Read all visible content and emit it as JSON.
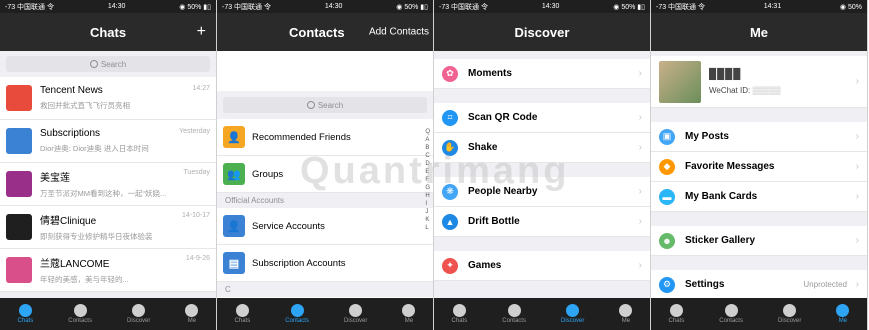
{
  "panels": [
    {
      "status": {
        "carrier": "-73 中国联通 令",
        "time": "14:30",
        "battery": "◉ 50% ▮▯"
      },
      "title": "Chats",
      "right": "+",
      "search": "Search",
      "chats": [
        {
          "name": "Tencent News",
          "time": "14:27",
          "preview": "救回并批式直飞飞行员亮相",
          "avatar_color": "#e84a3b"
        },
        {
          "name": "Subscriptions",
          "time": "Yesterday",
          "preview": "Dior迪奥: Dior迪奥 进入日本时间",
          "avatar_color": "#3b82d4"
        },
        {
          "name": "美宝莲",
          "time": "Tuesday",
          "preview": "万圣节派对MM看到这种，一起“妖娆...",
          "avatar_color": "#9a2f8a"
        },
        {
          "name": "倩碧Clinique",
          "time": "14-10-17",
          "preview": "即刻获得专业修护精华日夜体验装",
          "avatar_color": "#1f1f1f"
        },
        {
          "name": "兰蔻LANCOME",
          "time": "14-9-26",
          "preview": "年轻的美感，美与年轻的...",
          "avatar_color": "#d94f8a"
        }
      ],
      "tabs": [
        "Chats",
        "Contacts",
        "Discover",
        "Me"
      ],
      "active_tab": 0
    },
    {
      "status": {
        "carrier": "-73 中国联通 令",
        "time": "14:30",
        "battery": "◉ 50% ▮▯"
      },
      "title": "Contacts",
      "right": "Add Contacts",
      "search": "Search",
      "items": [
        {
          "label": "Recommended Friends",
          "color": "#f5a623",
          "glyph": "👤"
        },
        {
          "label": "Groups",
          "color": "#4caf50",
          "glyph": "👥"
        }
      ],
      "section_label": "Official Accounts",
      "items2": [
        {
          "label": "Service Accounts",
          "color": "#3b82d4",
          "glyph": "👤"
        },
        {
          "label": "Subscription Accounts",
          "color": "#3b82d4",
          "glyph": "▤"
        }
      ],
      "section_c": "C",
      "index": [
        "Q",
        "A",
        "B",
        "C",
        "D",
        "E",
        "F",
        "G",
        "H",
        "I",
        "J",
        "K",
        "L"
      ],
      "tabs": [
        "Chats",
        "Contacts",
        "Discover",
        "Me"
      ],
      "active_tab": 1
    },
    {
      "status": {
        "carrier": "-73 中国联通 令",
        "time": "14:30",
        "battery": "◉ 50% ▮▯"
      },
      "title": "Discover",
      "rows": [
        {
          "label": "Moments",
          "color": "#f06292",
          "glyph": "✿",
          "gap_after": true
        },
        {
          "label": "Scan QR Code",
          "color": "#2196f3",
          "glyph": "⌗",
          "gap_after": false
        },
        {
          "label": "Shake",
          "color": "#1e88e5",
          "glyph": "✋",
          "gap_after": true
        },
        {
          "label": "People Nearby",
          "color": "#42a5f5",
          "glyph": "❋",
          "gap_after": false
        },
        {
          "label": "Drift Bottle",
          "color": "#1e88e5",
          "glyph": "▲",
          "gap_after": true
        },
        {
          "label": "Games",
          "color": "#ef5350",
          "glyph": "✦",
          "gap_after": false
        }
      ],
      "tabs": [
        "Chats",
        "Contacts",
        "Discover",
        "Me"
      ],
      "active_tab": 2
    },
    {
      "status": {
        "carrier": "-73 中国联通 令",
        "time": "14:31",
        "battery": "◉ 50%"
      },
      "title": "Me",
      "profile_name": "████",
      "wechat_id_label": "WeChat ID:",
      "wechat_id_value": "▒▒▒▒▒",
      "rows": [
        {
          "label": "My Posts",
          "color": "#42a5f5",
          "glyph": "▣",
          "gap_after": false
        },
        {
          "label": "Favorite Messages",
          "color": "#ff9800",
          "glyph": "◆",
          "gap_after": false
        },
        {
          "label": "My Bank Cards",
          "color": "#29b6f6",
          "glyph": "▬",
          "gap_after": true
        },
        {
          "label": "Sticker Gallery",
          "color": "#66bb6a",
          "glyph": "☻",
          "gap_after": true
        },
        {
          "label": "Settings",
          "color": "#2196f3",
          "glyph": "⚙",
          "gap_after": false
        }
      ],
      "settings_status": "Unprotected",
      "tabs": [
        "Chats",
        "Contacts",
        "Discover",
        "Me"
      ],
      "active_tab": 3
    }
  ],
  "watermark": "Quantrimang"
}
